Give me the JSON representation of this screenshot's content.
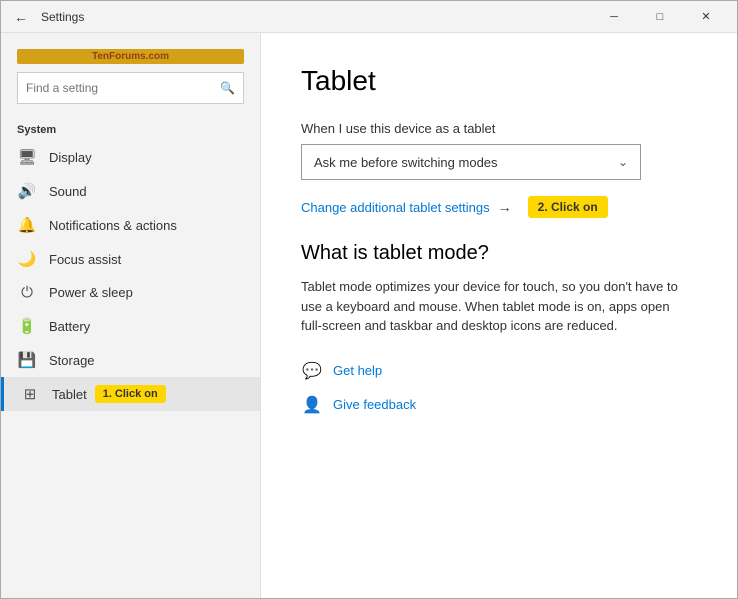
{
  "window": {
    "title": "Settings",
    "controls": {
      "minimize": "─",
      "maximize": "□",
      "close": "✕"
    }
  },
  "watermark": "TenForums.com",
  "search": {
    "placeholder": "Find a setting",
    "icon": "🔍"
  },
  "sidebar": {
    "section_label": "System",
    "items": [
      {
        "id": "display",
        "icon": "🖥",
        "label": "Display"
      },
      {
        "id": "sound",
        "icon": "🔊",
        "label": "Sound"
      },
      {
        "id": "notifications",
        "icon": "🔔",
        "label": "Notifications & actions"
      },
      {
        "id": "focus",
        "icon": "🌙",
        "label": "Focus assist"
      },
      {
        "id": "power",
        "icon": "⏻",
        "label": "Power & sleep"
      },
      {
        "id": "battery",
        "icon": "🔋",
        "label": "Battery"
      },
      {
        "id": "storage",
        "icon": "💾",
        "label": "Storage"
      },
      {
        "id": "tablet",
        "icon": "⊞",
        "label": "Tablet",
        "active": true
      }
    ],
    "tablet_badge": "1. Click on"
  },
  "content": {
    "title": "Tablet",
    "device_label": "When I use this device as a tablet",
    "dropdown_value": "Ask me before switching modes",
    "change_link": "Change additional tablet settings",
    "click_on_badge": "2. Click on",
    "what_is_title": "What is tablet mode?",
    "what_is_body": "Tablet mode optimizes your device for touch, so you don't have to use a keyboard and mouse. When tablet mode is on, apps open full-screen and taskbar and desktop icons are reduced.",
    "help_items": [
      {
        "id": "get-help",
        "icon": "💬",
        "label": "Get help"
      },
      {
        "id": "give-feedback",
        "icon": "👤",
        "label": "Give feedback"
      }
    ]
  }
}
